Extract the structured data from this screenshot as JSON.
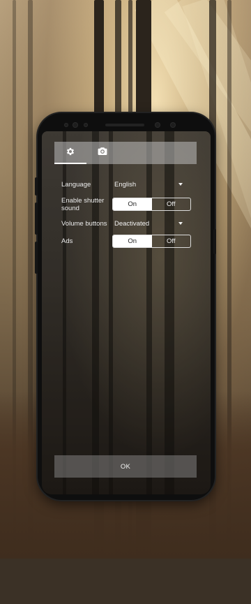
{
  "tabs": [
    {
      "icon": "gear-icon",
      "selected": true
    },
    {
      "icon": "camera-icon",
      "selected": false
    }
  ],
  "settings": {
    "language": {
      "label": "Language",
      "value": "English"
    },
    "shutter_sound": {
      "label_line1": "Enable shutter",
      "label_line2": "sound",
      "on": "On",
      "off": "Off",
      "selected": "On"
    },
    "volume_buttons": {
      "label": "Volume buttons",
      "value": "Deactivated"
    },
    "ads": {
      "label": "Ads",
      "on": "On",
      "off": "Off",
      "selected": "On"
    }
  },
  "ok_label": "OK",
  "colors": {
    "accent": "#ffffff",
    "panel": "#bebebe"
  }
}
